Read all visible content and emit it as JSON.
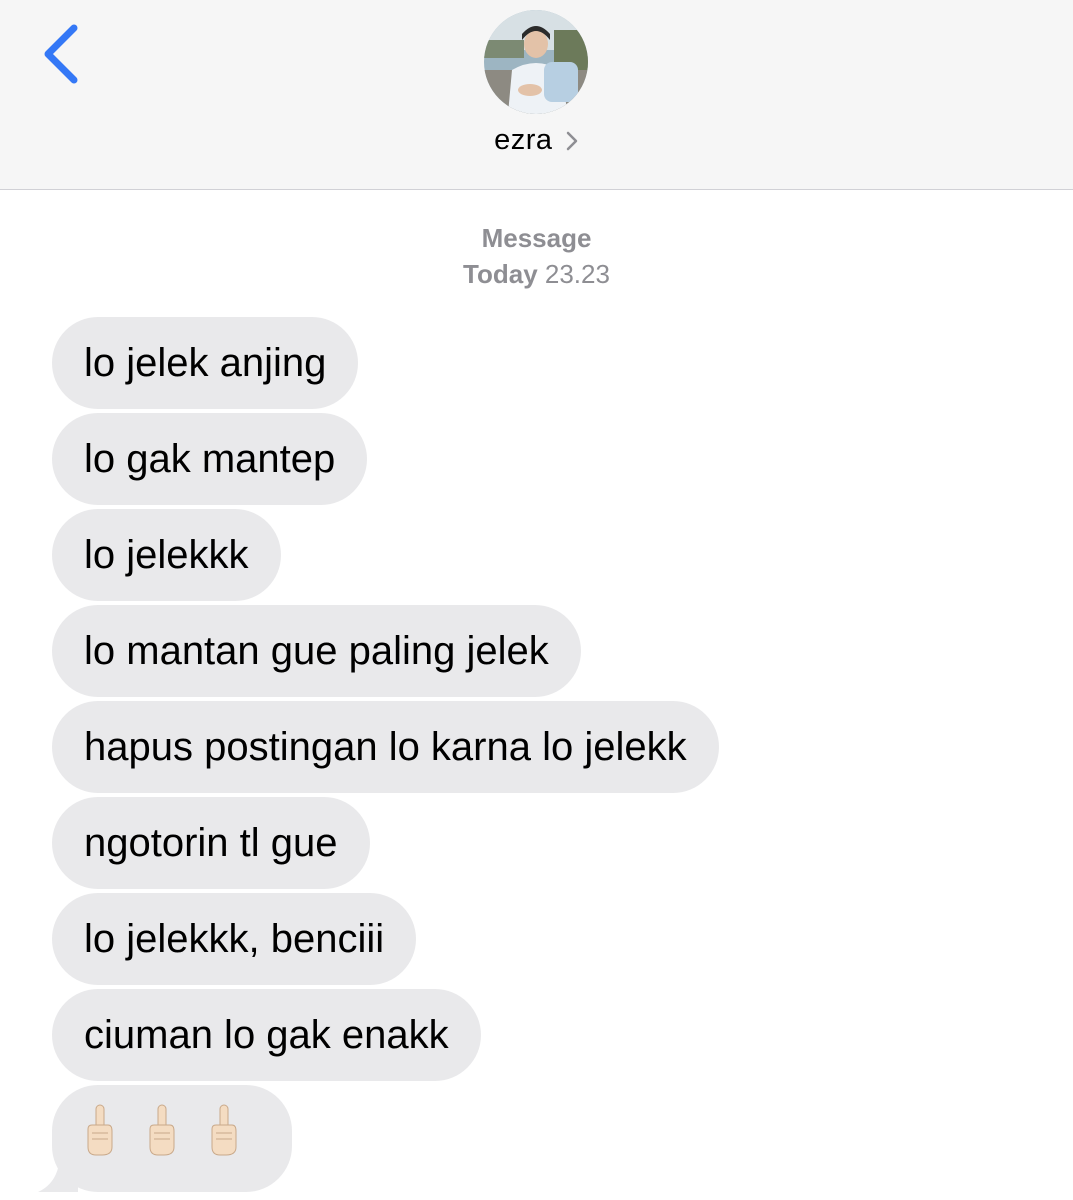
{
  "header": {
    "contact_name": "ezra",
    "back_icon": "chevron-left-icon",
    "detail_icon": "chevron-right-icon",
    "accent_color": "#3478f6"
  },
  "thread": {
    "service_label": "Message",
    "day_label": "Today",
    "time_label": "23.23"
  },
  "messages": [
    {
      "text": "lo jelek anjing"
    },
    {
      "text": "lo gak mantep"
    },
    {
      "text": "lo jelekkk"
    },
    {
      "text": "lo mantan gue paling jelek"
    },
    {
      "text": "hapus postingan lo karna lo jelekk"
    },
    {
      "text": "ngotorin tl gue"
    },
    {
      "text": "lo jelekkk, benciii"
    },
    {
      "text": "ciuman lo gak enakk"
    }
  ],
  "emoji_message": {
    "emoji": "middle-finger",
    "count": 3
  },
  "colors": {
    "header_bg": "#f6f6f6",
    "bubble_bg": "#e9e9eb",
    "meta_text": "#8e8e93"
  }
}
